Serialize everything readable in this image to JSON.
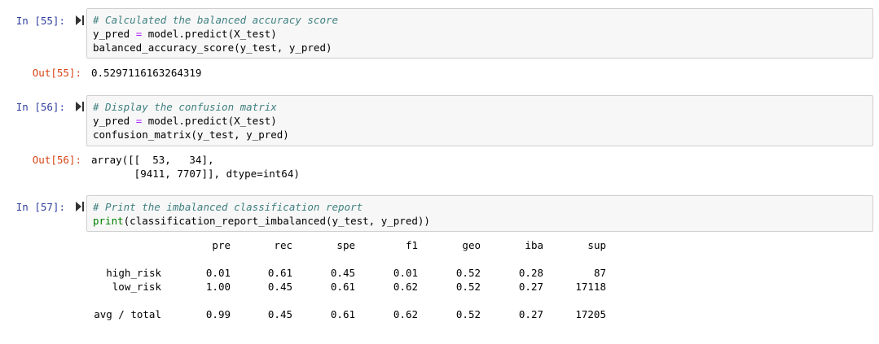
{
  "cells": [
    {
      "in_prompt": "In [55]:",
      "comment": "# Calculated the balanced accuracy score",
      "line2_var": "y_pred",
      "line2_op": "=",
      "line2_rest": "model.predict(X_test)",
      "line3": "balanced_accuracy_score(y_test, y_pred)",
      "out_prompt": "Out[55]:",
      "output": "0.5297116163264319"
    },
    {
      "in_prompt": "In [56]:",
      "comment": "# Display the confusion matrix",
      "line2_var": "y_pred",
      "line2_op": "=",
      "line2_rest": "model.predict(X_test)",
      "line3": "confusion_matrix(y_test, y_pred)",
      "out_prompt": "Out[56]:",
      "output_line1": "array([[  53,   34],",
      "output_line2": "       [9411, 7707]], dtype=int64)"
    },
    {
      "in_prompt": "In [57]:",
      "comment": "# Print the imbalanced classification report",
      "print_fn": "print",
      "print_rest": "(classification_report_imbalanced(y_test, y_pred))",
      "report": {
        "headers": [
          "pre",
          "rec",
          "spe",
          "f1",
          "geo",
          "iba",
          "sup"
        ],
        "rows": [
          {
            "label": "high_risk",
            "values": [
              "0.01",
              "0.61",
              "0.45",
              "0.01",
              "0.52",
              "0.28",
              "87"
            ]
          },
          {
            "label": "low_risk",
            "values": [
              "1.00",
              "0.45",
              "0.61",
              "0.62",
              "0.52",
              "0.27",
              "17118"
            ]
          }
        ],
        "total": {
          "label": "avg / total",
          "values": [
            "0.99",
            "0.45",
            "0.61",
            "0.62",
            "0.52",
            "0.27",
            "17205"
          ]
        }
      }
    }
  ],
  "icons": {
    "run": "run-cell-icon"
  },
  "colors": {
    "in_prompt": "#303f9f",
    "out_prompt": "#d84315",
    "comment": "#408080",
    "operator": "#aa22ff",
    "builtin": "#008000",
    "code_bg": "#f7f7f7"
  }
}
